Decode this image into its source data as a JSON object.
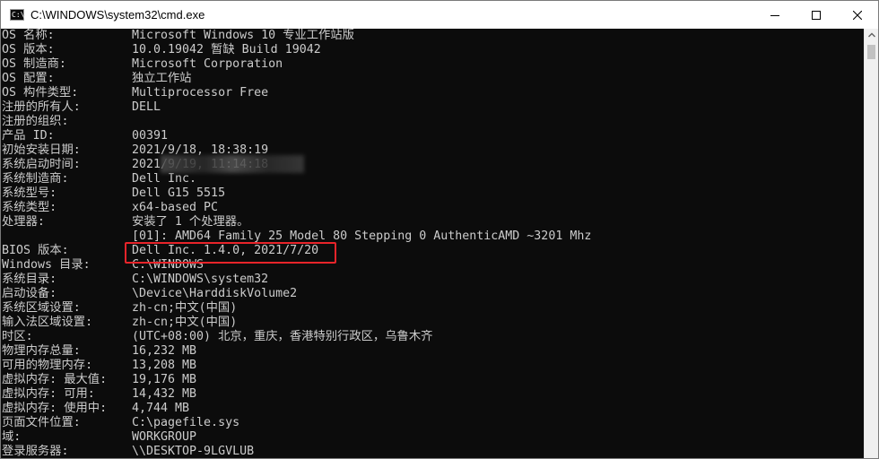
{
  "window": {
    "title": "C:\\WINDOWS\\system32\\cmd.exe",
    "icon_text": "C:\\"
  },
  "caption": {
    "minimize": "minimize-icon",
    "maximize": "maximize-icon",
    "close": "close-icon"
  },
  "console_lines": [
    {
      "label": "OS 名称:",
      "value": "Microsoft Windows 10 专业工作站版"
    },
    {
      "label": "OS 版本:",
      "value": "10.0.19042 暂缺 Build 19042"
    },
    {
      "label": "OS 制造商:",
      "value": "Microsoft Corporation"
    },
    {
      "label": "OS 配置:",
      "value": "独立工作站"
    },
    {
      "label": "OS 构件类型:",
      "value": "Multiprocessor Free"
    },
    {
      "label": "注册的所有人:",
      "value": "DELL"
    },
    {
      "label": "注册的组织:",
      "value": ""
    },
    {
      "label": "产品 ID:",
      "value": "00391"
    },
    {
      "label": "初始安装日期:",
      "value": "2021/9/18, 18:38:19"
    },
    {
      "label": "系统启动时间:",
      "value": "2021/9/19, 11:14:18"
    },
    {
      "label": "系统制造商:",
      "value": "Dell Inc."
    },
    {
      "label": "系统型号:",
      "value": "Dell G15 5515"
    },
    {
      "label": "系统类型:",
      "value": "x64-based PC"
    },
    {
      "label": "处理器:",
      "value": "安装了 1 个处理器。"
    },
    {
      "label": "",
      "value": "[01]: AMD64 Family 25 Model 80 Stepping 0 AuthenticAMD ~3201 Mhz"
    },
    {
      "label": "BIOS 版本:",
      "value": "Dell Inc. 1.4.0, 2021/7/20"
    },
    {
      "label": "Windows 目录:",
      "value": "C:\\WINDOWS"
    },
    {
      "label": "系统目录:",
      "value": "C:\\WINDOWS\\system32"
    },
    {
      "label": "启动设备:",
      "value": "\\Device\\HarddiskVolume2"
    },
    {
      "label": "系统区域设置:",
      "value": "zh-cn;中文(中国)"
    },
    {
      "label": "输入法区域设置:",
      "value": "zh-cn;中文(中国)"
    },
    {
      "label": "时区:",
      "value": "(UTC+08:00) 北京，重庆，香港特别行政区，乌鲁木齐"
    },
    {
      "label": "物理内存总量:",
      "value": "16,232 MB"
    },
    {
      "label": "可用的物理内存:",
      "value": "13,208 MB"
    },
    {
      "label": "虚拟内存: 最大值:",
      "value": "19,176 MB"
    },
    {
      "label": "虚拟内存: 可用:",
      "value": "14,432 MB"
    },
    {
      "label": "虚拟内存: 使用中:",
      "value": "4,744 MB"
    },
    {
      "label": "页面文件位置:",
      "value": "C:\\pagefile.sys"
    },
    {
      "label": "域:",
      "value": "WORKGROUP"
    },
    {
      "label": "登录服务器:",
      "value": "\\\\DESKTOP-9LGVLUB"
    }
  ],
  "colors": {
    "console_bg": "#0c0c0c",
    "console_fg": "#cccccc",
    "highlight": "#e8242a"
  }
}
